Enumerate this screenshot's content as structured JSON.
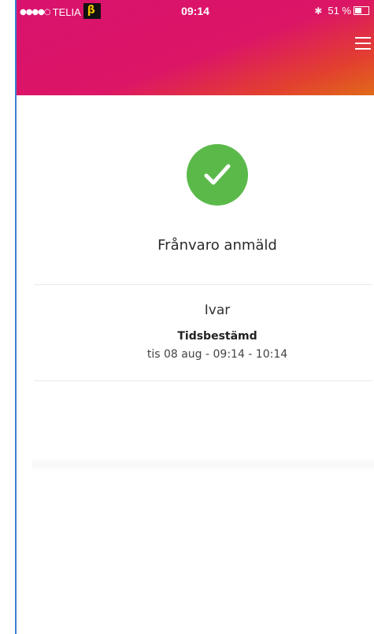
{
  "status_bar": {
    "signal_dots": "●●●●○",
    "carrier": "TELIA",
    "app_badge_glyph": "β",
    "time": "09:14",
    "bluetooth_icon": "bluetooth-icon",
    "battery_percent": "51 %",
    "battery_level": 0.51
  },
  "header": {
    "gradient_colors": [
      "#d9126e",
      "#e06a18"
    ],
    "menu_icon": "hamburger-menu-icon"
  },
  "confirmation": {
    "icon": "checkmark-icon",
    "icon_color": "#5bb94a",
    "title": "Frånvaro anmäld"
  },
  "absence": {
    "name": "Ivar",
    "type": "Tidsbestämd",
    "period": "tis 08 aug - 09:14 - 10:14"
  }
}
